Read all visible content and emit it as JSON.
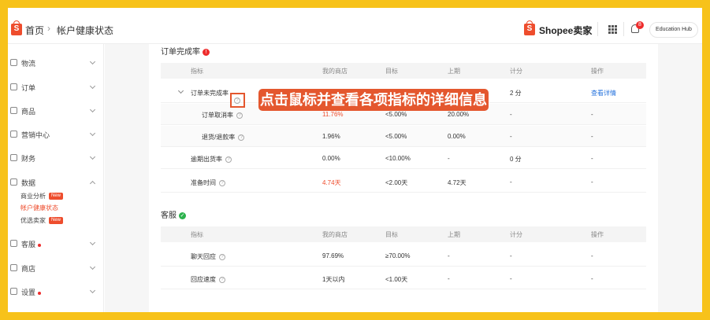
{
  "header": {
    "logo_letter": "S",
    "breadcrumb_home": "首页",
    "breadcrumb_sep": "›",
    "breadcrumb_current": "帐户健康状态",
    "seller_brand": "Shopee卖家",
    "notification_count": "8",
    "education_hub": "Education Hub"
  },
  "sidebar": {
    "items": [
      {
        "label": "物流",
        "dot": false
      },
      {
        "label": "订单",
        "dot": false
      },
      {
        "label": "商品",
        "dot": false
      },
      {
        "label": "营销中心",
        "dot": false
      },
      {
        "label": "财务",
        "dot": false
      },
      {
        "label": "数据",
        "dot": false
      },
      {
        "label": "客服",
        "dot": true
      },
      {
        "label": "商店",
        "dot": false
      },
      {
        "label": "设置",
        "dot": true
      }
    ],
    "data_sub": [
      {
        "label": "商业分析",
        "tag": "New"
      },
      {
        "label": "帐户健康状态",
        "tag": ""
      },
      {
        "label": "优选卖家",
        "tag": "New"
      }
    ]
  },
  "order_section": {
    "title": "订单完成率",
    "icon_symbol": "!",
    "icon_color": "#ee2c2c",
    "headers": [
      "指标",
      "我的商店",
      "目标",
      "上期",
      "计分",
      "操作"
    ],
    "rows": [
      {
        "metric": "订单未完成率",
        "my_store": "",
        "target": "",
        "last": "",
        "score": "2 分",
        "action": "查看详情",
        "highlight": false,
        "sub": false
      },
      {
        "metric": "订单取消率",
        "my_store": "11.76%",
        "target": "<5.00%",
        "last": "20.00%",
        "score": "-",
        "action": "-",
        "highlight": true,
        "sub": true
      },
      {
        "metric": "退货/退款率",
        "my_store": "1.96%",
        "target": "<5.00%",
        "last": "0.00%",
        "score": "-",
        "action": "-",
        "highlight": false,
        "sub": true
      },
      {
        "metric": "逾期出货率",
        "my_store": "0.00%",
        "target": "<10.00%",
        "last": "-",
        "score": "0 分",
        "action": "-",
        "highlight": false,
        "sub": false
      },
      {
        "metric": "准备时间",
        "my_store": "4.74天",
        "target": "<2.00天",
        "last": "4.72天",
        "score": "-",
        "action": "-",
        "highlight": true,
        "sub": false
      }
    ]
  },
  "service_section": {
    "title": "客服",
    "icon_symbol": "✓",
    "icon_color": "#2bb24c",
    "headers": [
      "指标",
      "我的商店",
      "目标",
      "上期",
      "计分",
      "操作"
    ],
    "rows": [
      {
        "metric": "聊天回应",
        "my_store": "97.69%",
        "target": "≥70.00%",
        "last": "-",
        "score": "-",
        "action": "-"
      },
      {
        "metric": "回应速度",
        "my_store": "1天以内",
        "target": "<1.00天",
        "last": "-",
        "score": "-",
        "action": "-"
      }
    ]
  },
  "callout": {
    "text": "点击鼠标并查看各项指标的详细信息",
    "color": "#e4572e"
  },
  "colors": {
    "frame_border": "#f7c21a",
    "brand": "#ee4d2d",
    "link": "#2673dd"
  }
}
